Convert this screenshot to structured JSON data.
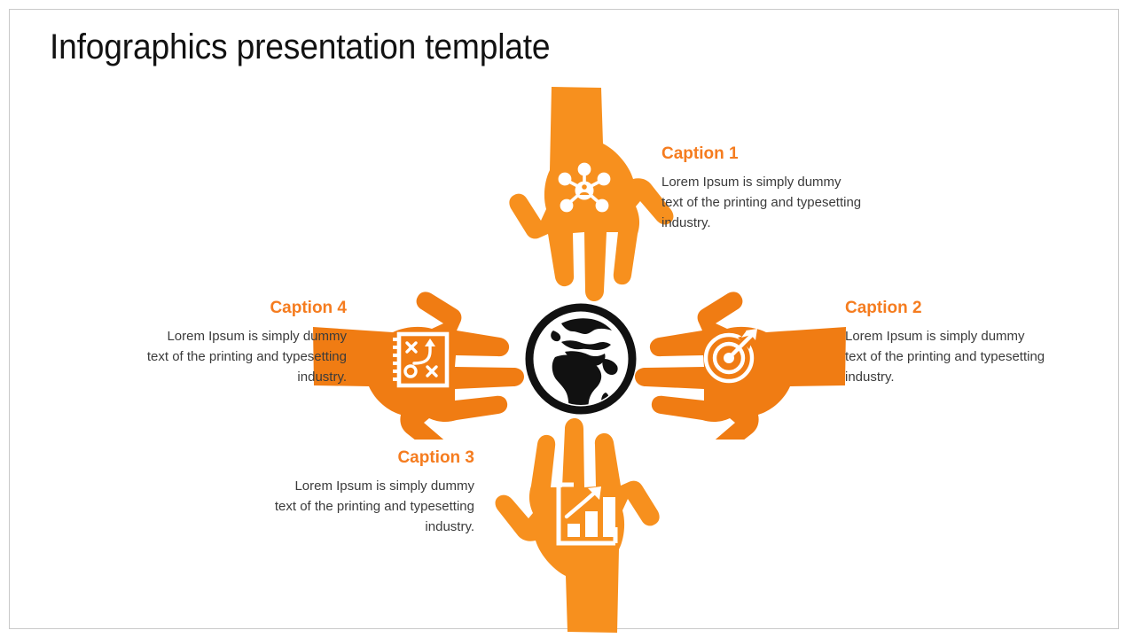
{
  "slide": {
    "title": "Infographics presentation template",
    "background_color": "#FFFFFF",
    "border_color": "#C9C9C9",
    "accent_color": "#F7901E",
    "caption_title_color": "#F57C1F",
    "body_text_color": "#3B3B3B",
    "title_color": "#121212"
  },
  "center": {
    "icon": "globe-icon",
    "icon_color": "#111111"
  },
  "items": [
    {
      "id": "item-1",
      "position": "top",
      "icon": "network-hub-icon",
      "title": "Caption 1",
      "body": "Lorem Ipsum is simply dummy text of the printing and typesetting industry.",
      "align": "left",
      "hand_color": "#F7901E"
    },
    {
      "id": "item-2",
      "position": "right",
      "icon": "target-arrow-icon",
      "title": "Caption 2",
      "body": "Lorem Ipsum is simply dummy text of the printing and typesetting industry.",
      "align": "left",
      "hand_color": "#F07C13"
    },
    {
      "id": "item-3",
      "position": "bottom",
      "icon": "bar-chart-growth-icon",
      "title": "Caption 3",
      "body": "Lorem Ipsum is simply dummy text of the printing and typesetting industry.",
      "align": "right",
      "hand_color": "#F7901E"
    },
    {
      "id": "item-4",
      "position": "left",
      "icon": "strategy-board-icon",
      "title": "Caption 4",
      "body": "Lorem Ipsum is simply dummy text of the printing and typesetting industry.",
      "align": "right",
      "hand_color": "#F07C13"
    }
  ]
}
